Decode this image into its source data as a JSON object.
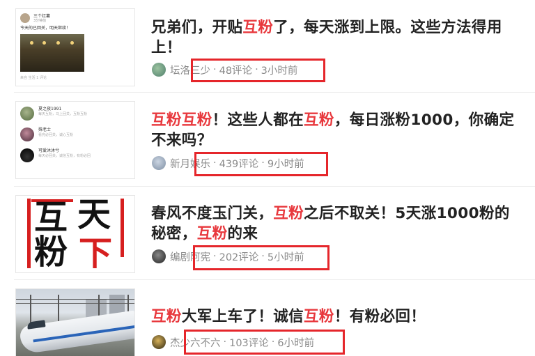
{
  "colors": {
    "highlight": "#e8383d",
    "redbox": "#e5262b",
    "meta_text": "#8a8a8a"
  },
  "feed": [
    {
      "title_parts": [
        {
          "text": "兄弟们，开贴",
          "hl": false
        },
        {
          "text": "互粉",
          "hl": true
        },
        {
          "text": "了，每天涨到上限。这些方法得用上！",
          "hl": false
        }
      ],
      "author": "坛洛三少",
      "comments": "48评论",
      "time": "3小时前",
      "thumb": {
        "kind": "post-screenshot",
        "name": "三个红薯",
        "sub": "3分钟前",
        "text": "今天的已回关，明天继续！",
        "foot": "来自 生活 1 评论"
      }
    },
    {
      "title_parts": [
        {
          "text": "互粉互粉",
          "hl": true
        },
        {
          "text": "！这些人都在",
          "hl": false
        },
        {
          "text": "互粉",
          "hl": true
        },
        {
          "text": "，每日涨粉1000，你确定不来吗？",
          "hl": false
        }
      ],
      "author": "新月娱乐",
      "comments": "439评论",
      "time": "9小时前",
      "thumb": {
        "kind": "account-list",
        "accounts": [
          {
            "name": "夏之夜1991",
            "desc": "每天互粉，马上回关，互粉互粉"
          },
          {
            "name": "殊老士",
            "desc": "看完必回关，诚心互粉"
          },
          {
            "name": "可爱沐沐兮",
            "desc": "每天必回关，诚信互粉，有粉必回"
          }
        ]
      }
    },
    {
      "title_parts": [
        {
          "text": "春风不度玉门关，",
          "hl": false
        },
        {
          "text": "互粉",
          "hl": true
        },
        {
          "text": "之后不取关！5天涨1000粉的秘密，",
          "hl": false
        },
        {
          "text": "互粉",
          "hl": true
        },
        {
          "text": "的来",
          "hl": false
        }
      ],
      "author": "编剧阿宪",
      "comments": "202评论",
      "time": "5小时前",
      "thumb": {
        "kind": "calligraphy",
        "chars": [
          "互",
          "天",
          "粉",
          "下"
        ]
      }
    },
    {
      "title_parts": [
        {
          "text": "互粉",
          "hl": true
        },
        {
          "text": "大军上车了！诚信",
          "hl": false
        },
        {
          "text": "互粉",
          "hl": true
        },
        {
          "text": "！有粉必回！",
          "hl": false
        }
      ],
      "author": "杰少六不六",
      "comments": "103评论",
      "time": "6小时前",
      "thumb": {
        "kind": "train-photo"
      }
    }
  ]
}
